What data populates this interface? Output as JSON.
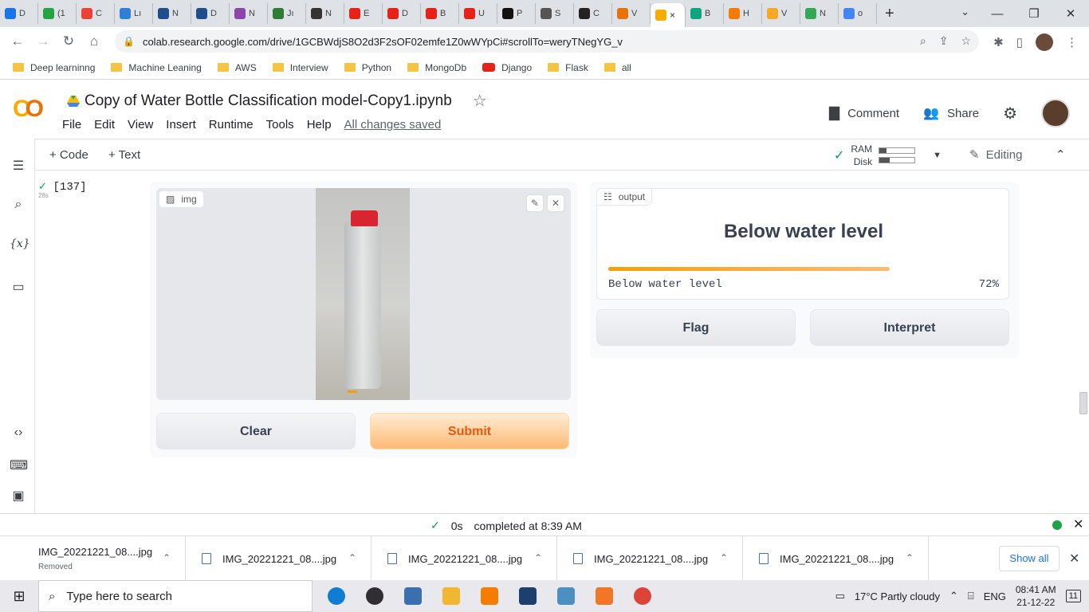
{
  "browser": {
    "tabs": [
      {
        "label": "D",
        "color": "#1a73e8"
      },
      {
        "label": "(1",
        "color": "#25a244"
      },
      {
        "label": "C",
        "color": "#ea4335"
      },
      {
        "label": "Lı",
        "color": "#2f7fd4"
      },
      {
        "label": "N",
        "color": "#1f4e8c"
      },
      {
        "label": "D",
        "color": "#1f4e8c"
      },
      {
        "label": "N",
        "color": "#8e44ad"
      },
      {
        "label": "Jı",
        "color": "#2e7d32"
      },
      {
        "label": "N",
        "color": "#333333"
      },
      {
        "label": "E",
        "color": "#e62117"
      },
      {
        "label": "D",
        "color": "#e62117"
      },
      {
        "label": "B",
        "color": "#e62117"
      },
      {
        "label": "U",
        "color": "#e62117"
      },
      {
        "label": "P",
        "color": "#111111"
      },
      {
        "label": "S",
        "color": "#555555"
      },
      {
        "label": "C",
        "color": "#222222"
      },
      {
        "label": "V",
        "color": "#e8710a"
      }
    ],
    "active_tab_close": "×",
    "tabs_after": [
      {
        "label": "B",
        "color": "#10a37f"
      },
      {
        "label": "H",
        "color": "#f57c00"
      },
      {
        "label": "V",
        "color": "#f9a825"
      },
      {
        "label": "N",
        "color": "#34a853"
      },
      {
        "label": "o",
        "color": "#4285f4"
      }
    ],
    "new_tab": "+",
    "url": "colab.research.google.com/drive/1GCBWdjS8O2d3F2sOF02emfe1Z0wWYpCi#scrollTo=weryTNegYG_v"
  },
  "bookmarks": [
    {
      "label": "Deep learninng",
      "icon": "folder"
    },
    {
      "label": "Machine Leaning",
      "icon": "folder"
    },
    {
      "label": "AWS",
      "icon": "folder"
    },
    {
      "label": "Interview",
      "icon": "folder"
    },
    {
      "label": "Python",
      "icon": "folder"
    },
    {
      "label": "MongoDb",
      "icon": "folder"
    },
    {
      "label": "Django",
      "icon": "youtube"
    },
    {
      "label": "Flask",
      "icon": "folder"
    },
    {
      "label": "all",
      "icon": "folder"
    }
  ],
  "colab": {
    "title": "Copy of Water Bottle Classification model-Copy1.ipynb",
    "menu": [
      "File",
      "Edit",
      "View",
      "Insert",
      "Runtime",
      "Tools",
      "Help"
    ],
    "saved_status": "All changes saved",
    "comment_label": "Comment",
    "share_label": "Share",
    "add_code": "+ Code",
    "add_text": "+ Text",
    "ram_label": "RAM",
    "disk_label": "Disk",
    "ram_usage": 0.2,
    "disk_usage": 0.3,
    "editing_label": "Editing"
  },
  "cell": {
    "exec_count": "[137]",
    "exec_time": "28s"
  },
  "gradio": {
    "input_label": "img",
    "output_label": "output",
    "prediction": "Below water level",
    "confidence_label": "Below water level",
    "confidence_text": "72%",
    "confidence_value": 0.72,
    "clear_label": "Clear",
    "submit_label": "Submit",
    "flag_label": "Flag",
    "interpret_label": "Interpret"
  },
  "status": {
    "duration": "0s",
    "message": "completed at 8:39 AM"
  },
  "downloads": {
    "items": [
      {
        "name": "IMG_20221221_08....jpg",
        "sub": "Removed"
      },
      {
        "name": "IMG_20221221_08....jpg",
        "sub": ""
      },
      {
        "name": "IMG_20221221_08....jpg",
        "sub": ""
      },
      {
        "name": "IMG_20221221_08....jpg",
        "sub": ""
      },
      {
        "name": "IMG_20221221_08....jpg",
        "sub": ""
      }
    ],
    "show_all": "Show all"
  },
  "taskbar": {
    "search_placeholder": "Type here to search",
    "apps": [
      {
        "name": "edge",
        "color": "#0f7dd4"
      },
      {
        "name": "obs",
        "color": "#302e31"
      },
      {
        "name": "explorer-window",
        "color": "#3a6fb0"
      },
      {
        "name": "file-explorer",
        "color": "#f2b630"
      },
      {
        "name": "vlc",
        "color": "#f57c00"
      },
      {
        "name": "anaconda",
        "color": "#1d3f6e"
      },
      {
        "name": "snip",
        "color": "#4a90c2"
      },
      {
        "name": "jupyter",
        "color": "#f37626"
      },
      {
        "name": "chrome",
        "color": "#db4437"
      }
    ],
    "weather": "17°C  Partly cloudy",
    "lang": "ENG",
    "time": "08:41 AM",
    "date": "21-12-22",
    "notifications": "11"
  }
}
